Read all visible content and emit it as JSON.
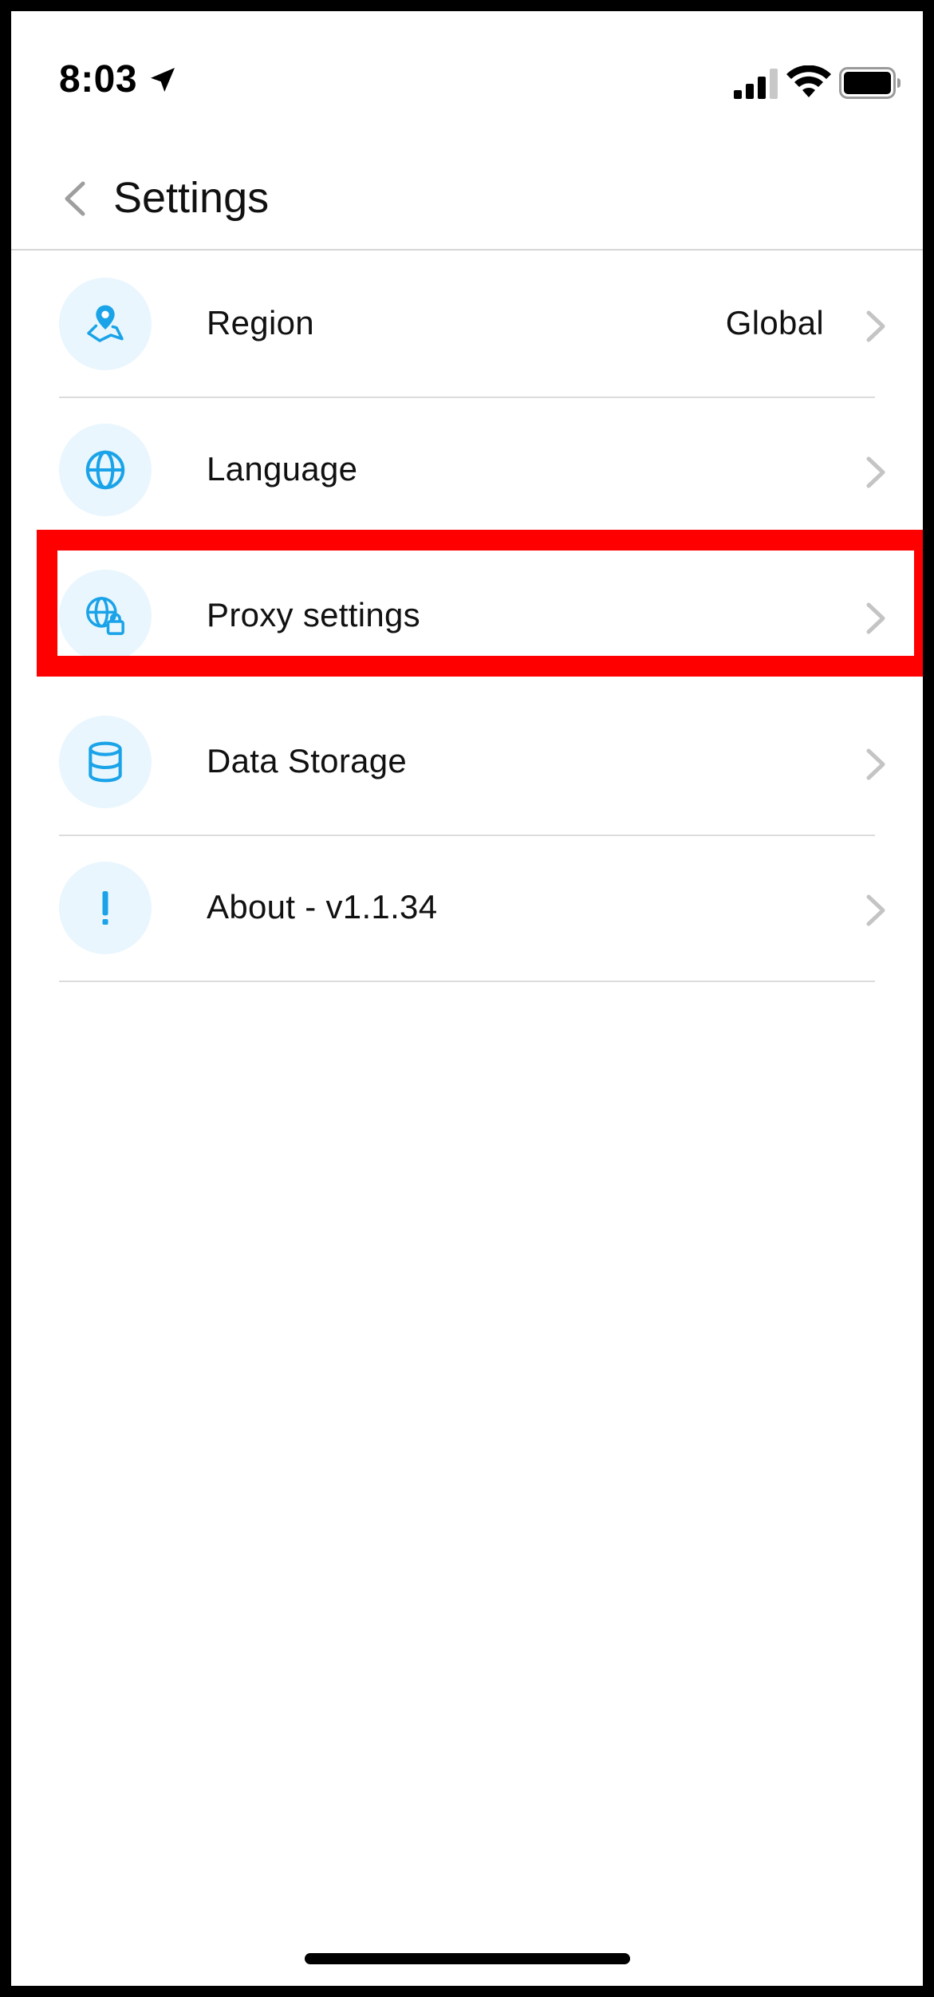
{
  "status_bar": {
    "time": "8:03"
  },
  "header": {
    "title": "Settings"
  },
  "settings": {
    "items": [
      {
        "label": "Region",
        "value": "Global",
        "icon": "map-pin-icon"
      },
      {
        "label": "Language",
        "value": "",
        "icon": "globe-icon"
      },
      {
        "label": "Proxy settings",
        "value": "",
        "icon": "globe-lock-icon"
      },
      {
        "label": "Data Storage",
        "value": "",
        "icon": "database-icon"
      },
      {
        "label": "About - v1.1.34",
        "value": "",
        "icon": "exclamation-icon"
      }
    ]
  },
  "colors": {
    "accent": "#1aa3e8",
    "icon_bg": "#e9f6fd",
    "highlight": "#ff0000",
    "chevron": "#c4c4c4",
    "divider": "#dcdcdc"
  }
}
